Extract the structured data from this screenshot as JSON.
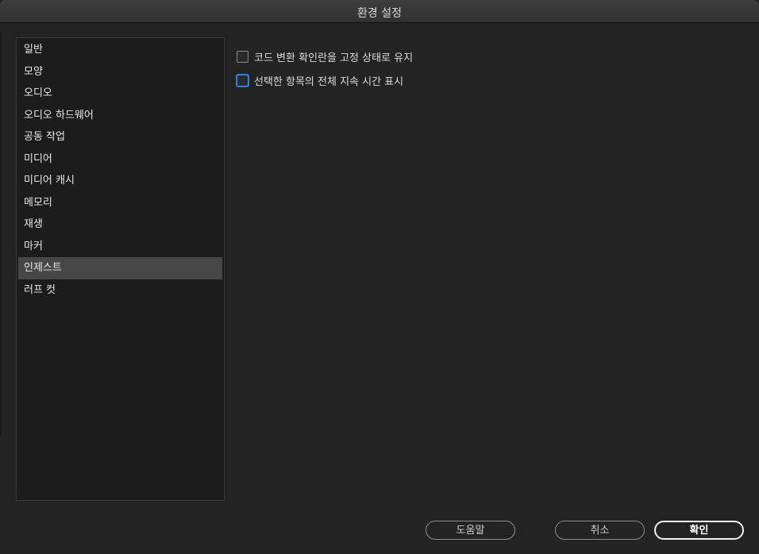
{
  "window": {
    "title": "환경 설정"
  },
  "sidebar": {
    "items": [
      {
        "label": "일반",
        "selected": false
      },
      {
        "label": "모양",
        "selected": false
      },
      {
        "label": "오디오",
        "selected": false
      },
      {
        "label": "오디오 하드웨어",
        "selected": false
      },
      {
        "label": "공동 작업",
        "selected": false
      },
      {
        "label": "미디어",
        "selected": false
      },
      {
        "label": "미디어 캐시",
        "selected": false
      },
      {
        "label": "메모리",
        "selected": false
      },
      {
        "label": "재생",
        "selected": false
      },
      {
        "label": "마커",
        "selected": false
      },
      {
        "label": "인제스트",
        "selected": true
      },
      {
        "label": "러프 컷",
        "selected": false
      }
    ]
  },
  "options": [
    {
      "label": "코드 변환 확인란을 고정 상태로 유지",
      "checked": false,
      "focused": false
    },
    {
      "label": "선택한 항목의 전체 지속 시간 표시",
      "checked": false,
      "focused": true
    }
  ],
  "buttons": {
    "help": "도움말",
    "cancel": "취소",
    "ok": "확인"
  },
  "colors": {
    "background": "#232323",
    "selected_item": "#474747",
    "focus_ring": "#3f8ff5"
  }
}
